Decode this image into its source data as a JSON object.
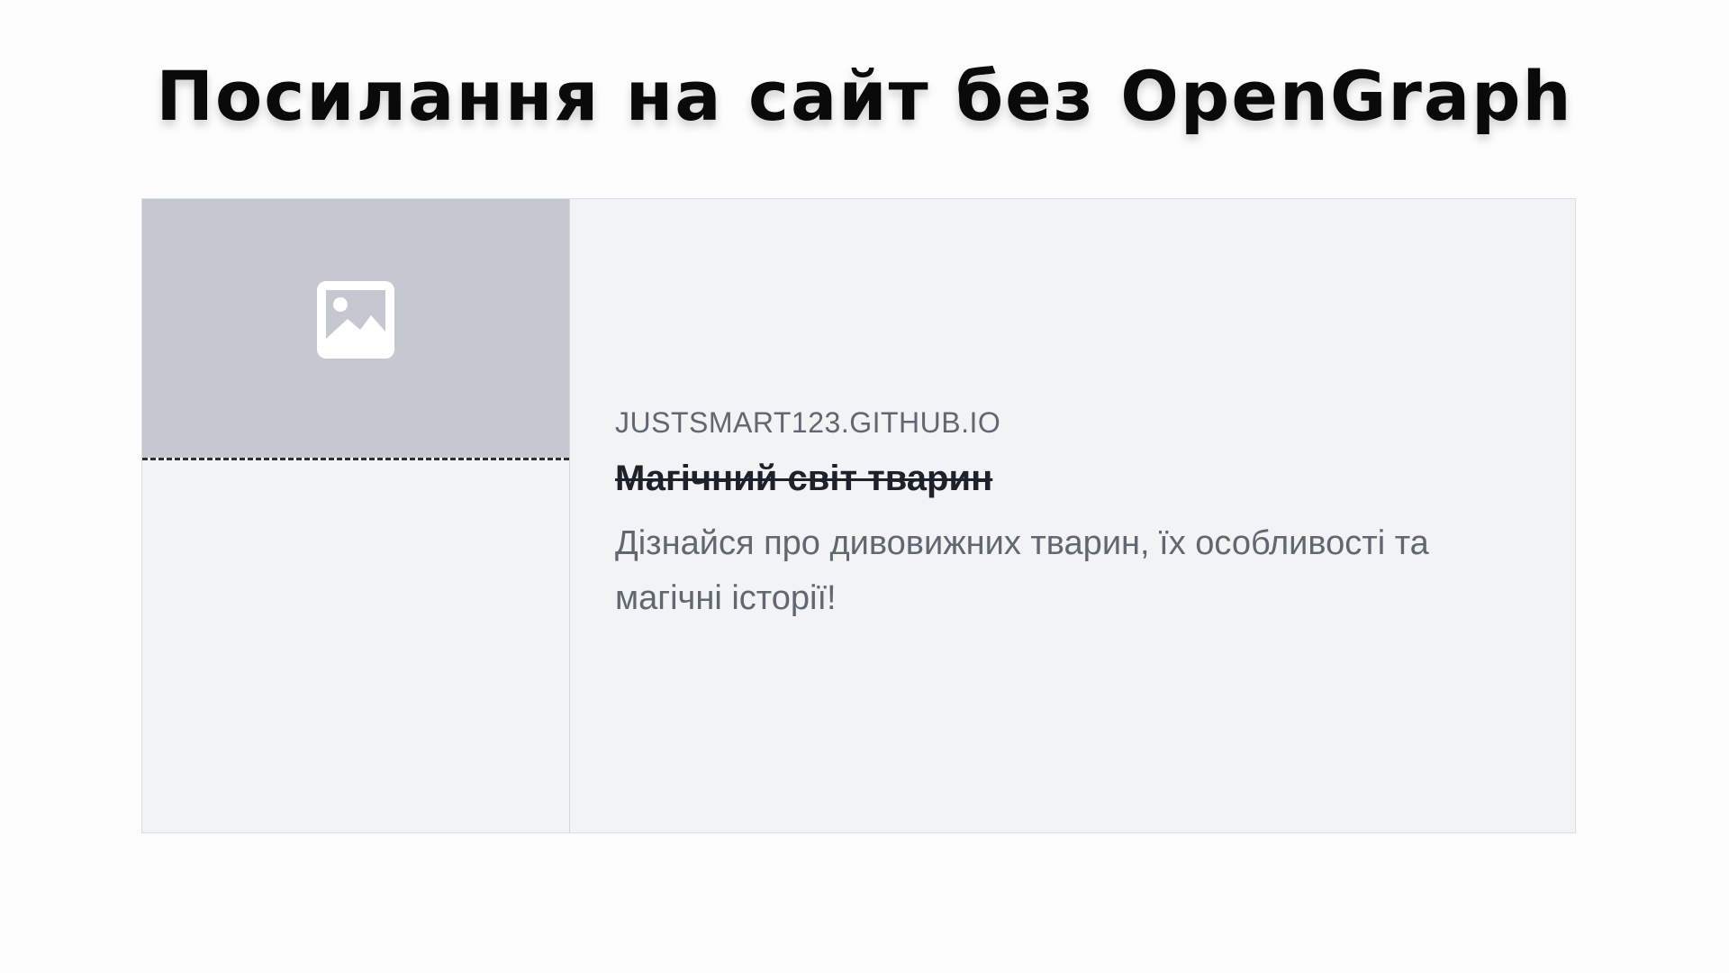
{
  "title": "Посилання на сайт без OpenGraph",
  "card": {
    "domain": "JUSTSMART123.GITHUB.IO",
    "headline": "Магічний світ тварин",
    "description": "Дізнайся про дивовижних тварин, їх особливості та магічні історії!",
    "image_icon": "image-placeholder-icon"
  },
  "colors": {
    "image_placeholder_bg": "#c5c8d1",
    "card_bg": "#f2f3f5",
    "domain_text": "#606770",
    "headline_text": "#1d2129"
  }
}
